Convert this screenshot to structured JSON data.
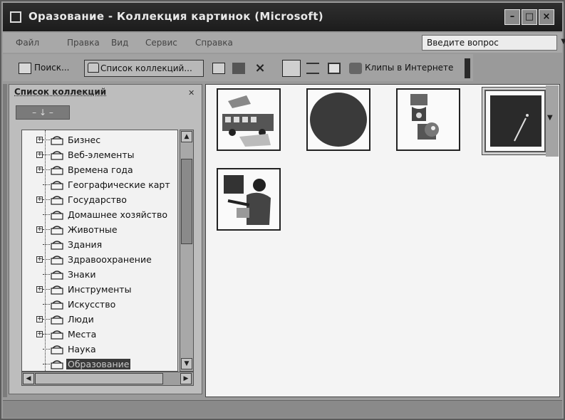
{
  "window": {
    "title": "Оразование  - Коллекция картинок (Microsoft)",
    "controls": [
      "minimize",
      "maximize",
      "close"
    ]
  },
  "menubar": {
    "items": [
      "Файл",
      "Правка",
      "Вид",
      "Сервис",
      "Справка"
    ],
    "ask_placeholder": "Введите вопрос"
  },
  "toolbar": {
    "search_label": "Поиск...",
    "collections_label": "Список коллекций...",
    "clips_online_label": "Клипы в Интернете"
  },
  "panel": {
    "title": "Список коллекций"
  },
  "tree": {
    "items": [
      {
        "label": "Бизнес",
        "expandable": true
      },
      {
        "label": "Веб-элементы",
        "expandable": true
      },
      {
        "label": "Времена года",
        "expandable": true
      },
      {
        "label": "Географические карт",
        "expandable": false
      },
      {
        "label": "Государство",
        "expandable": true
      },
      {
        "label": "Домашнее хозяйство",
        "expandable": false
      },
      {
        "label": "Животные",
        "expandable": true
      },
      {
        "label": "Здания",
        "expandable": false
      },
      {
        "label": "Здравоохранение",
        "expandable": true
      },
      {
        "label": "Знаки",
        "expandable": false
      },
      {
        "label": "Инструменты",
        "expandable": true
      },
      {
        "label": "Искусство",
        "expandable": false
      },
      {
        "label": "Люди",
        "expandable": true
      },
      {
        "label": "Места",
        "expandable": true
      },
      {
        "label": "Наука",
        "expandable": false
      },
      {
        "label": "Образование",
        "expandable": false,
        "selected": true
      }
    ]
  },
  "clips": [
    {
      "icon": "school-bus-icon"
    },
    {
      "icon": "dark-oval-icon"
    },
    {
      "icon": "reading-figures-icon"
    },
    {
      "icon": "chalkboard-icon"
    },
    {
      "icon": "teacher-icon"
    }
  ],
  "colors": {
    "titlebar": "#232323",
    "selection": "#3a3a3a"
  }
}
